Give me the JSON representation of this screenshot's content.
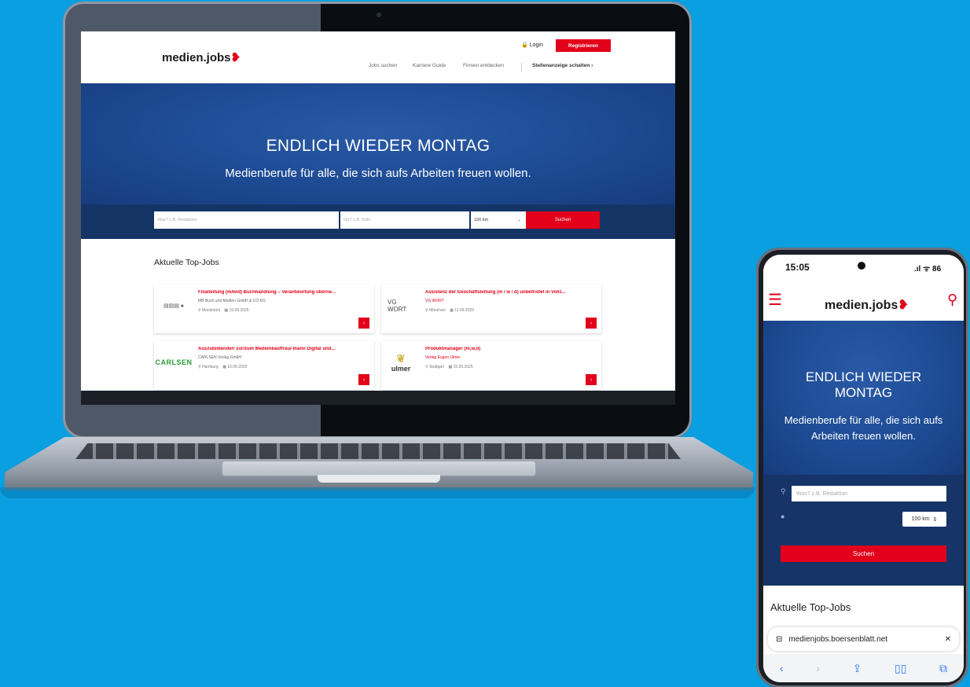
{
  "desktop": {
    "logo": "medien.jobs",
    "logo_mark": "❥",
    "login": "Login",
    "register": "Registrieren",
    "nav": [
      "Jobs suchen",
      "Karriere Guide",
      "Firmen entdecken",
      "Stellenanzeige schalten ›"
    ],
    "hero_title": "ENDLICH WIEDER MONTAG",
    "hero_subtitle": "Medienberufe für alle, die sich aufs Arbeiten freuen wollen.",
    "search": {
      "what_placeholder": "Was? z.B. Redaktion",
      "where_placeholder": "Ort? z.B. Köln",
      "radius": "100 km",
      "button": "Suchen"
    },
    "top_jobs_title": "Aktuelle Top-Jobs",
    "jobs": [
      {
        "title": "Filialleitung (m/w/d) Buchhandlung – Verantwortung überne...",
        "company": "MB Buch und Medien GmbH & CO KG",
        "location": "Möckmühl",
        "date": "15.09.2025",
        "logo_text": "▤▤▤ ●"
      },
      {
        "title": "Assistenz der Geschäftsleitung (m / w / d) unbefristet in Vollz...",
        "company": "VG WORT",
        "location": "München",
        "date": "11.09.2025",
        "logo_text": "VG WORT"
      },
      {
        "title": "Auszubildende/r zur/zum Medienkauffrau/-mann Digital und...",
        "company": "CARLSEN Verlag GmbH",
        "location": "Hamburg",
        "date": "16.09.2025",
        "logo_text": "CARLSEN"
      },
      {
        "title": "Produktmanager (m,w,d)",
        "company": "Verlag Eugen Ulmer",
        "location": "Stuttgart",
        "date": "15.09.2025",
        "logo_text": "ulmer"
      }
    ]
  },
  "phone": {
    "time": "15:05",
    "status_icons": ".ıl ᯤ 86",
    "logo": "medien.jobs",
    "hero_title": "ENDLICH WIEDER MONTAG",
    "hero_subtitle": "Medienberufe für alle, die sich aufs Arbeiten freuen wollen.",
    "search_placeholder": "Was? z.B. Redaktion",
    "radius": "100 km",
    "search_button": "Suchen",
    "top_jobs_title": "Aktuelle Top-Jobs",
    "url": "medienjobs.boersenblatt.net",
    "toolbar_icons": [
      "back-icon",
      "forward-icon",
      "share-icon",
      "bookmarks-icon",
      "tabs-icon"
    ]
  },
  "colors": {
    "brand_red": "#e2001a",
    "hero_blue": "#1d4a93",
    "background_blue": "#0a9fe0"
  }
}
